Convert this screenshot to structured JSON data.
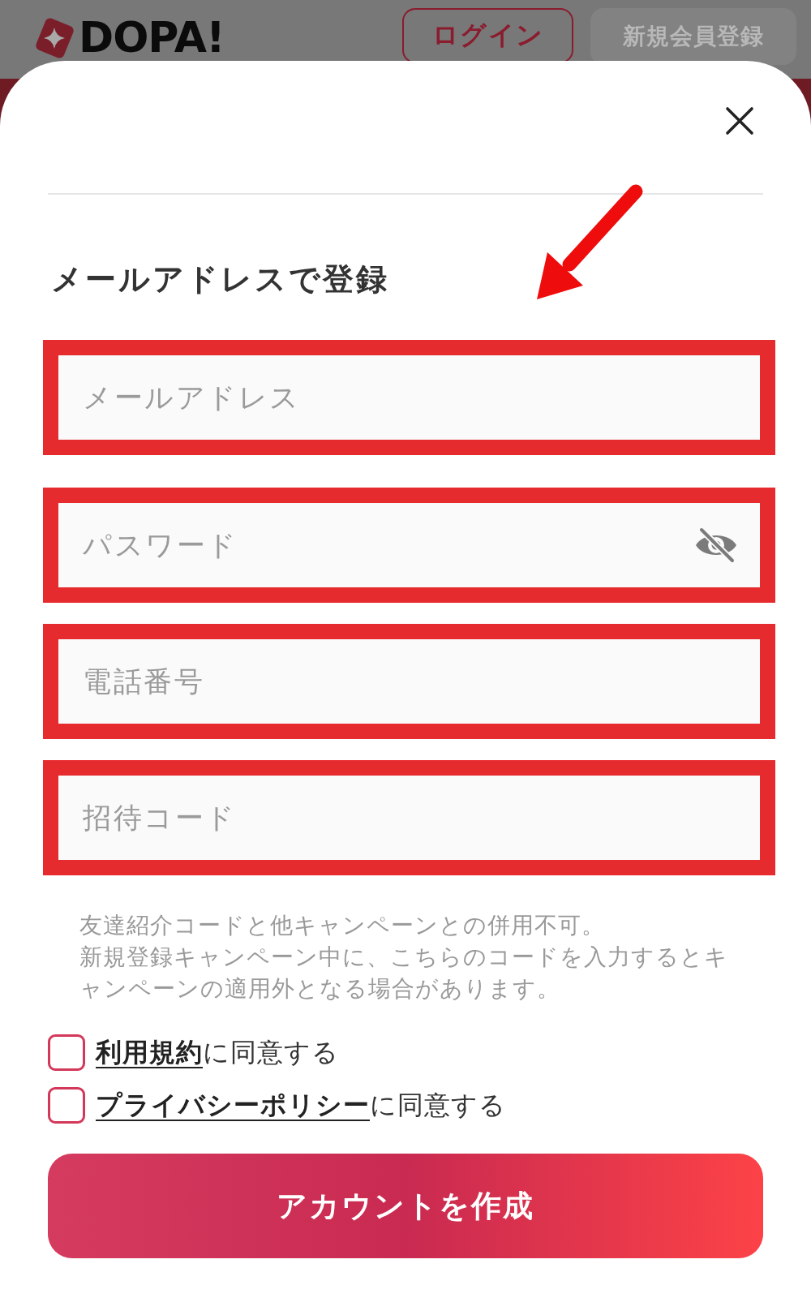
{
  "header": {
    "logo": "DOPA!",
    "buttons": [
      {
        "label": "ログイン",
        "kind": "outline"
      },
      {
        "label": "新規会員登録",
        "kind": "filled"
      }
    ]
  },
  "signup_sheet": {
    "heading": "メールアドレスで登録",
    "fields": [
      {
        "kind": "email",
        "placeholder": "メールアドレス",
        "highlighted": true
      },
      {
        "kind": "password",
        "placeholder": "パスワード",
        "highlighted": true
      },
      {
        "kind": "phone",
        "placeholder": "電話番号",
        "highlighted": true
      },
      {
        "kind": "code",
        "placeholder": "招待コード",
        "highlighted": true
      }
    ],
    "notes": [
      "友達紹介コードと他キャンペーンとの併用不可。",
      "新規登録キャンペーン中に、こちらのコードを入力するとキャンペーンの適用外となる場合があります。"
    ],
    "agreements": [
      {
        "link": "利用規約",
        "text": "に同意する",
        "checked": false
      },
      {
        "link": "プライバシーポリシー",
        "text": "に同意する",
        "checked": false
      }
    ],
    "submit": "アカウントを作成"
  },
  "annotations": [
    {
      "kind": "arrow"
    }
  ]
}
